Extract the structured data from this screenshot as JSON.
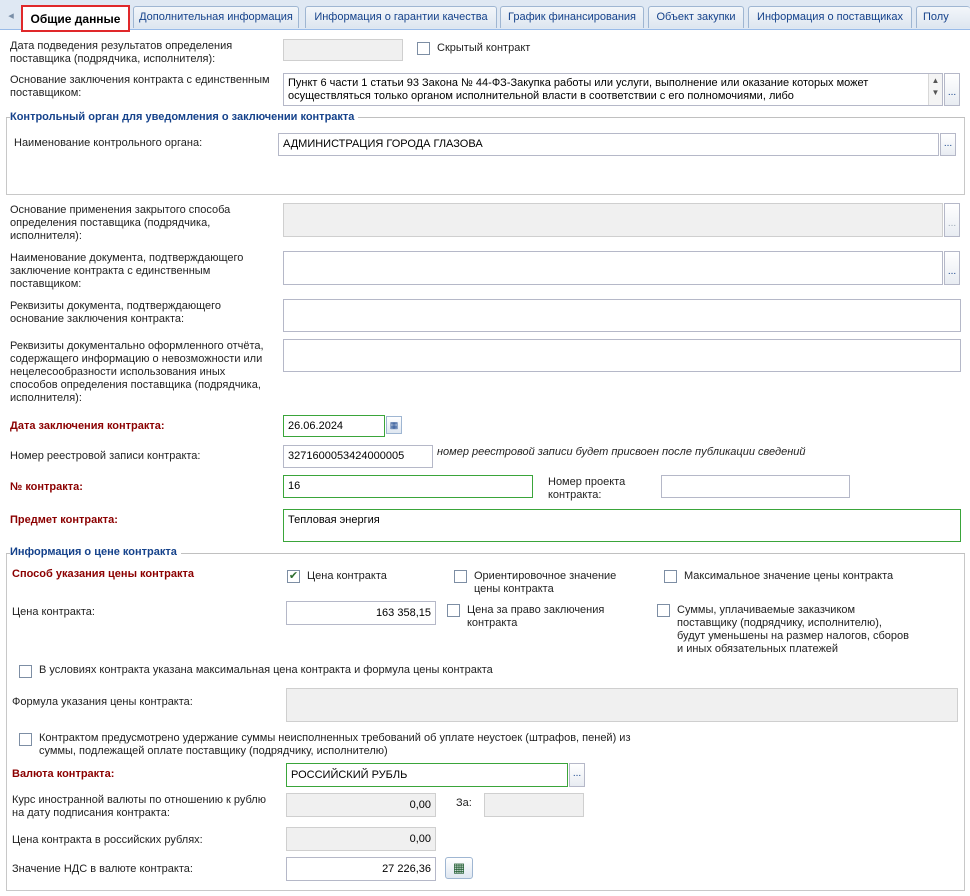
{
  "tabs": [
    {
      "label": "Общие данные"
    },
    {
      "label": "Дополнительная информация"
    },
    {
      "label": "Информация о гарантии качества"
    },
    {
      "label": "График финансирования"
    },
    {
      "label": "Объект закупки"
    },
    {
      "label": "Информация о поставщиках"
    },
    {
      "label": "Полу"
    }
  ],
  "icons": {
    "tab_scroll_left": "◂",
    "ellipsis": "...",
    "checkmark": "✔",
    "calendar": "▦",
    "calculator": "▦",
    "scroll_up": "▲",
    "scroll_down": "▼"
  },
  "form": {
    "results_date_label": "Дата подведения результатов определения поставщика (подрядчика, исполнителя):",
    "results_date_value": "",
    "hidden_contract_label": "Скрытый контракт",
    "hidden_contract_checked": false,
    "single_supplier_basis_label": "Основание заключения контракта с единственным поставщиком:",
    "single_supplier_basis_value": "Пункт 6 части 1 статьи 93 Закона № 44-ФЗ-Закупка работы или услуги, выполнение или оказание которых может осуществляться только органом исполнительной власти в соответствии с его полномочиями, либо",
    "control_section_title": "Контрольный орган для уведомления о заключении контракта",
    "control_body_label": "Наименование контрольного органа:",
    "control_body_value": "АДМИНИСТРАЦИЯ ГОРОДА ГЛАЗОВА",
    "closed_method_label": "Основание применения закрытого способа определения поставщика (подрядчика, исполнителя):",
    "closed_method_value": "",
    "doc_name_label": "Наименование документа, подтверждающего заключение контракта с единственным поставщиком:",
    "doc_name_value": "",
    "doc_requisites_label": "Реквизиты документа, подтверждающего основание заключения контракта:",
    "doc_requisites_value": "",
    "report_requisites_label": "Реквизиты документально оформленного отчёта, содержащего информацию о невозможности или нецелесообразности использования иных способов определения поставщика (подрядчика, исполнителя):",
    "report_requisites_value": "",
    "contract_date_label": "Дата заключения контракта:",
    "contract_date_value": "26.06.2024",
    "registry_number_label": "Номер реестровой записи контракта:",
    "registry_number_value": "3271600053424000005",
    "registry_number_note": "номер реестровой записи будет присвоен после публикации сведений",
    "contract_number_label": "№ контракта:",
    "contract_number_value": "16",
    "draft_number_label": "Номер проекта контракта:",
    "draft_number_value": "",
    "subject_label": "Предмет контракта:",
    "subject_value": "Тепловая энергия"
  },
  "price": {
    "section_title": "Информация о цене контракта",
    "method_label": "Способ указания цены контракта",
    "option_price_label": "Цена контракта",
    "option_price_checked": true,
    "option_approx_label": "Ориентировочное значение цены контракта",
    "option_approx_checked": false,
    "option_max_label": "Максимальное значение цены контракта",
    "option_max_checked": false,
    "price_label": "Цена контракта:",
    "price_value": "163 358,15",
    "right_to_conclude_label": "Цена за право заключения контракта",
    "right_to_conclude_checked": false,
    "reduced_sums_label": "Суммы, уплачиваемые заказчиком поставщику (подрядчику, исполнителю), будут уменьшены на размер налогов, сборов и иных обязательных платежей",
    "reduced_sums_checked": false,
    "max_formula_label": "В условиях контракта указана максимальная цена контракта и формула цены контракта",
    "max_formula_checked": false,
    "formula_label": "Формула указания цены контракта:",
    "formula_value": "",
    "withholding_label": "Контрактом предусмотрено удержание суммы неисполненных требований об уплате неустоек (штрафов, пеней) из суммы, подлежащей оплате поставщику (подрядчику, исполнителю)",
    "withholding_checked": false,
    "currency_label": "Валюта контракта:",
    "currency_value": "РОССИЙСКИЙ РУБЛЬ",
    "fx_rate_label": "Курс иностранной валюты по отношению к рублю на дату подписания контракта:",
    "fx_rate_value": "0,00",
    "per_label": "За:",
    "per_value": "",
    "rub_price_label": "Цена контракта в российских рублях:",
    "rub_price_value": "0,00",
    "vat_label": "Значение НДС в валюте контракта:",
    "vat_value": "27 226,36"
  }
}
